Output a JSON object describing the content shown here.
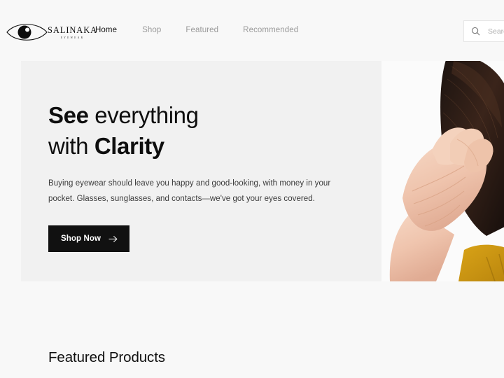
{
  "brand": {
    "name": "SALINAKA",
    "tagline": "EYEWEAR",
    "logo_icon": "eye-icon"
  },
  "nav": {
    "items": [
      {
        "label": "Home",
        "active": true
      },
      {
        "label": "Shop",
        "active": false
      },
      {
        "label": "Featured",
        "active": false
      },
      {
        "label": "Recommended",
        "active": false
      }
    ]
  },
  "search": {
    "icon": "search-icon",
    "placeholder": "Search...",
    "value": ""
  },
  "hero": {
    "title_part1": "See",
    "title_part2": " everything",
    "title_part3": "with ",
    "title_part4": "Clarity",
    "paragraph": "Buying eyewear should leave you happy and good-looking, with money in your pocket. Glasses, sunglasses, and contacts—we've got your eyes covered.",
    "cta_label": "Shop Now",
    "cta_icon": "arrow-right-icon",
    "image_alt": "woman-with-hand-near-face-photo",
    "background_color": "#f1f1f1",
    "cta_background_color": "#111111"
  },
  "featured": {
    "title": "Featured Products"
  },
  "theme": {
    "page_background": "#f8f8f8",
    "text_color": "#1a1a1a",
    "muted_text_color": "#9a9a9a"
  }
}
